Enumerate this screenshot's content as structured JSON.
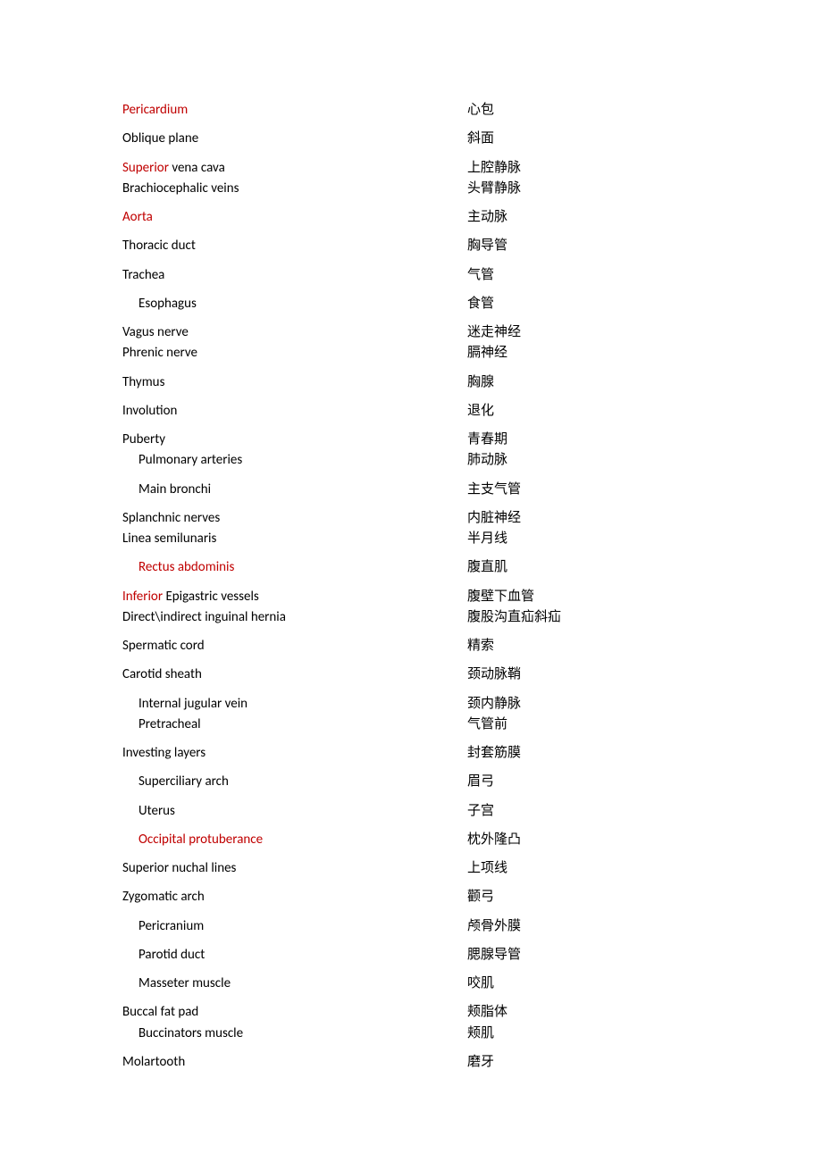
{
  "rows": [
    {
      "en": [
        {
          "t": "Pericardium",
          "c": "red"
        }
      ],
      "cn": "心包",
      "indent": 0,
      "gap": false
    },
    {
      "en": [
        {
          "t": "Oblique plane"
        }
      ],
      "cn": "斜面",
      "indent": 0,
      "gap": true
    },
    {
      "en": [
        {
          "t": "Superior ",
          "c": "red"
        },
        {
          "t": "vena cava"
        }
      ],
      "cn": "上腔静脉",
      "indent": 0,
      "gap": true
    },
    {
      "en": [
        {
          "t": "Brachiocephalic veins"
        }
      ],
      "cn": "头臂静脉",
      "indent": 0,
      "gap": false
    },
    {
      "en": [
        {
          "t": "Aorta",
          "c": "red"
        }
      ],
      "cn": "主动脉",
      "indent": 0,
      "gap": true
    },
    {
      "en": [
        {
          "t": "Thoracic duct"
        }
      ],
      "cn": "胸导管",
      "indent": 0,
      "gap": true
    },
    {
      "en": [
        {
          "t": "Trachea"
        }
      ],
      "cn": "气管",
      "indent": 0,
      "gap": true
    },
    {
      "en": [
        {
          "t": "Esophagus"
        }
      ],
      "cn": "食管",
      "indent": 1,
      "gap": true
    },
    {
      "en": [
        {
          "t": "Vagus nerve"
        }
      ],
      "cn": "迷走神经",
      "indent": 0,
      "gap": true
    },
    {
      "en": [
        {
          "t": "Phrenic nerve"
        }
      ],
      "cn": "膈神经",
      "indent": 0,
      "gap": false
    },
    {
      "en": [
        {
          "t": "Thymus"
        }
      ],
      "cn": "胸腺",
      "indent": 0,
      "gap": true
    },
    {
      "en": [
        {
          "t": "Involution"
        }
      ],
      "cn": "退化",
      "indent": 0,
      "gap": true
    },
    {
      "en": [
        {
          "t": "Puberty"
        }
      ],
      "cn": "青春期",
      "indent": 0,
      "gap": true
    },
    {
      "en": [
        {
          "t": "Pulmonary arteries"
        }
      ],
      "cn": "肺动脉",
      "indent": 1,
      "gap": false
    },
    {
      "en": [
        {
          "t": "Main bronchi"
        }
      ],
      "cn": "主支气管",
      "indent": 1,
      "gap": true
    },
    {
      "en": [
        {
          "t": "Splanchnic nerves"
        }
      ],
      "cn": "内脏神经",
      "indent": 0,
      "gap": true
    },
    {
      "en": [
        {
          "t": "Linea semilunaris"
        }
      ],
      "cn": "半月线",
      "indent": 0,
      "gap": false
    },
    {
      "en": [
        {
          "t": "Rectus abdominis",
          "c": "red"
        }
      ],
      "cn": "腹直肌",
      "indent": 1,
      "gap": true
    },
    {
      "en": [
        {
          "t": "Inferior ",
          "c": "red"
        },
        {
          "t": "Epigastric vessels"
        }
      ],
      "cn": "腹壁下血管",
      "indent": 0,
      "gap": true
    },
    {
      "en": [
        {
          "t": "Direct\\indirect inguinal hernia"
        }
      ],
      "cn": "腹股沟直疝斜疝",
      "indent": 0,
      "gap": false
    },
    {
      "en": [
        {
          "t": "Spermatic cord"
        }
      ],
      "cn": "精索",
      "indent": 0,
      "gap": true
    },
    {
      "en": [
        {
          "t": "Carotid sheath"
        }
      ],
      "cn": "颈动脉鞘",
      "indent": 0,
      "gap": true
    },
    {
      "en": [
        {
          "t": "Internal jugular vein"
        }
      ],
      "cn": "颈内静脉",
      "indent": 1,
      "gap": true
    },
    {
      "en": [
        {
          "t": "Pretracheal"
        }
      ],
      "cn": "气管前",
      "indent": 1,
      "gap": false
    },
    {
      "en": [
        {
          "t": "Investing layers"
        }
      ],
      "cn": "封套筋膜",
      "indent": 0,
      "gap": true
    },
    {
      "en": [
        {
          "t": "Superciliary arch"
        }
      ],
      "cn": "眉弓",
      "indent": 1,
      "gap": true
    },
    {
      "en": [
        {
          "t": "Uterus"
        }
      ],
      "cn": "子宫",
      "indent": 1,
      "gap": true
    },
    {
      "en": [
        {
          "t": "Occipital protuberance",
          "c": "red"
        }
      ],
      "cn": "枕外隆凸",
      "indent": 1,
      "gap": true
    },
    {
      "en": [
        {
          "t": "Superior nuchal lines"
        }
      ],
      "cn": "上项线",
      "indent": 0,
      "gap": true
    },
    {
      "en": [
        {
          "t": "Zygomatic arch"
        }
      ],
      "cn": "颧弓",
      "indent": 0,
      "gap": true
    },
    {
      "en": [
        {
          "t": "Pericranium"
        }
      ],
      "cn": "颅骨外膜",
      "indent": 1,
      "gap": true
    },
    {
      "en": [
        {
          "t": "Parotid duct"
        }
      ],
      "cn": "腮腺导管",
      "indent": 1,
      "gap": true
    },
    {
      "en": [
        {
          "t": "Masseter muscle"
        }
      ],
      "cn": "咬肌",
      "indent": 1,
      "gap": true
    },
    {
      "en": [
        {
          "t": "Buccal fat pad"
        }
      ],
      "cn": "颊脂体",
      "indent": 0,
      "gap": true
    },
    {
      "en": [
        {
          "t": "Buccinators muscle"
        }
      ],
      "cn": "颊肌",
      "indent": 1,
      "gap": false
    },
    {
      "en": [
        {
          "t": "Molartooth"
        }
      ],
      "cn": "磨牙",
      "indent": 0,
      "gap": true
    }
  ]
}
